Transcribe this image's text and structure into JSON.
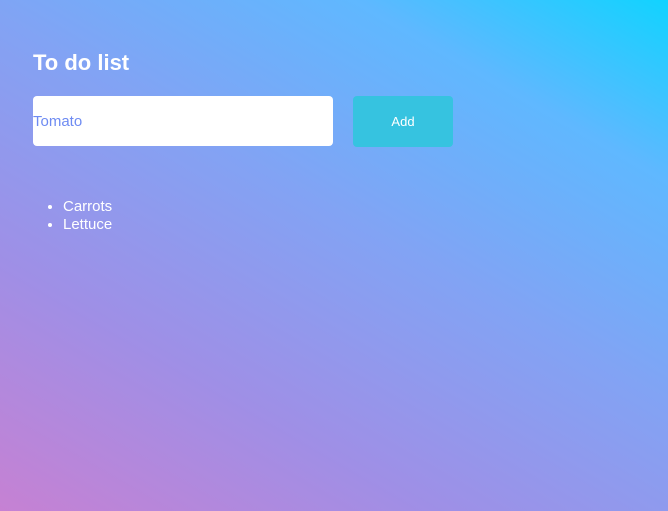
{
  "header": {
    "title": "To do list"
  },
  "form": {
    "input_value": "Tomato",
    "add_label": "Add"
  },
  "list": {
    "items": [
      {
        "label": "Carrots"
      },
      {
        "label": "Lettuce"
      }
    ]
  }
}
